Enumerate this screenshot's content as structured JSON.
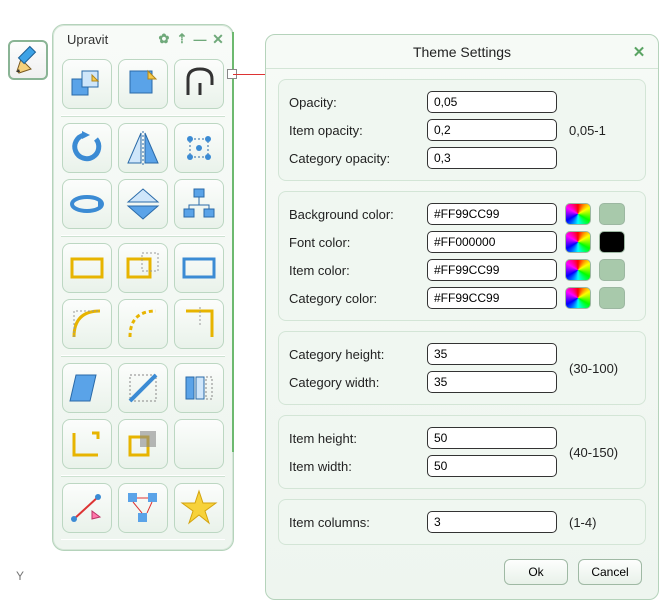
{
  "palette": {
    "title": "Upravit",
    "header_icons": [
      "gear-icon",
      "pin-icon",
      "minimize-icon",
      "close-icon"
    ]
  },
  "dialog": {
    "title": "Theme Settings",
    "sections": {
      "opacity": {
        "rows": [
          {
            "label": "Opacity:",
            "value": "0,05"
          },
          {
            "label": "Item opacity:",
            "value": "0,2"
          },
          {
            "label": "Category opacity:",
            "value": "0,3"
          }
        ],
        "hint": "0,05-1"
      },
      "colors": {
        "rows": [
          {
            "label": "Background color:",
            "value": "#FF99CC99",
            "swatch": "#a8c9ab"
          },
          {
            "label": "Font color:",
            "value": "#FF000000",
            "swatch": "#000000"
          },
          {
            "label": "Item color:",
            "value": "#FF99CC99",
            "swatch": "#a8c9ab"
          },
          {
            "label": "Category color:",
            "value": "#FF99CC99",
            "swatch": "#a8c9ab"
          }
        ]
      },
      "category_size": {
        "rows": [
          {
            "label": "Category height:",
            "value": "35"
          },
          {
            "label": "Category width:",
            "value": "35"
          }
        ],
        "hint": "(30-100)"
      },
      "item_size": {
        "rows": [
          {
            "label": "Item height:",
            "value": "50"
          },
          {
            "label": "Item width:",
            "value": "50"
          }
        ],
        "hint": "(40-150)"
      },
      "columns": {
        "label": "Item columns:",
        "value": "3",
        "hint": "(1-4)"
      }
    },
    "buttons": {
      "ok": "Ok",
      "cancel": "Cancel"
    }
  },
  "axis_y_label": "Y"
}
